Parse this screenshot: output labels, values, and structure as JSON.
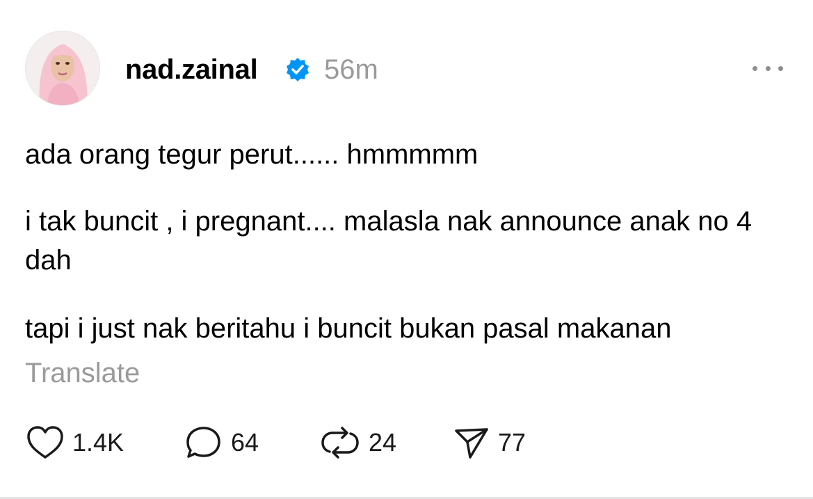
{
  "author": {
    "username": "nad.zainal",
    "verified": true,
    "avatar_icon": "profile-photo-avatar",
    "timestamp": "56m"
  },
  "post": {
    "paragraphs": [
      "ada orang tegur perut...... hmmmmm",
      "i tak buncit , i pregnant.... malasla nak announce anak no 4 dah",
      "tapi i just nak beritahu i buncit bukan pasal makanan"
    ],
    "translate_label": "Translate"
  },
  "actions": {
    "likes": "1.4K",
    "replies": "64",
    "reposts": "24",
    "shares": "77"
  },
  "colors": {
    "verified_badge": "#0095f6",
    "muted_text": "#9a9a9a",
    "avatar_hijab": "#f5c6d0"
  }
}
